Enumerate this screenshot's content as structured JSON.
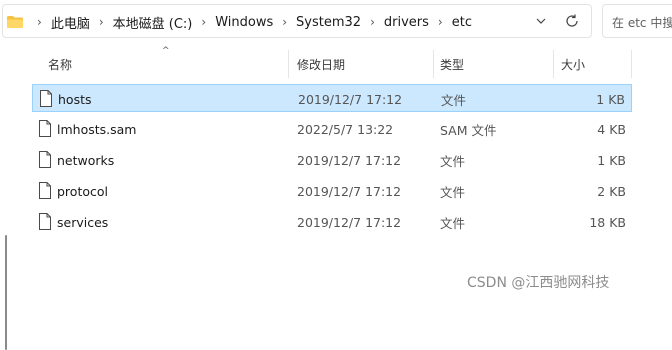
{
  "address_bar": {
    "breadcrumbs": [
      "此电脑",
      "本地磁盘 (C:)",
      "Windows",
      "System32",
      "drivers",
      "etc"
    ],
    "separator": "›"
  },
  "search": {
    "placeholder": "在 etc 中搜"
  },
  "columns": {
    "name": "名称",
    "date": "修改日期",
    "type": "类型",
    "size": "大小"
  },
  "files": [
    {
      "name": "hosts",
      "date": "2019/12/7 17:12",
      "type": "文件",
      "size": "1 KB",
      "selected": true
    },
    {
      "name": "lmhosts.sam",
      "date": "2022/5/7 13:22",
      "type": "SAM 文件",
      "size": "4 KB",
      "selected": false
    },
    {
      "name": "networks",
      "date": "2019/12/7 17:12",
      "type": "文件",
      "size": "1 KB",
      "selected": false
    },
    {
      "name": "protocol",
      "date": "2019/12/7 17:12",
      "type": "文件",
      "size": "2 KB",
      "selected": false
    },
    {
      "name": "services",
      "date": "2019/12/7 17:12",
      "type": "文件",
      "size": "18 KB",
      "selected": false
    }
  ],
  "watermark": "CSDN @江西驰网科技",
  "colors": {
    "selection_bg": "#cce8ff",
    "selection_border": "#99d1ff",
    "folder": "#f5c242"
  }
}
